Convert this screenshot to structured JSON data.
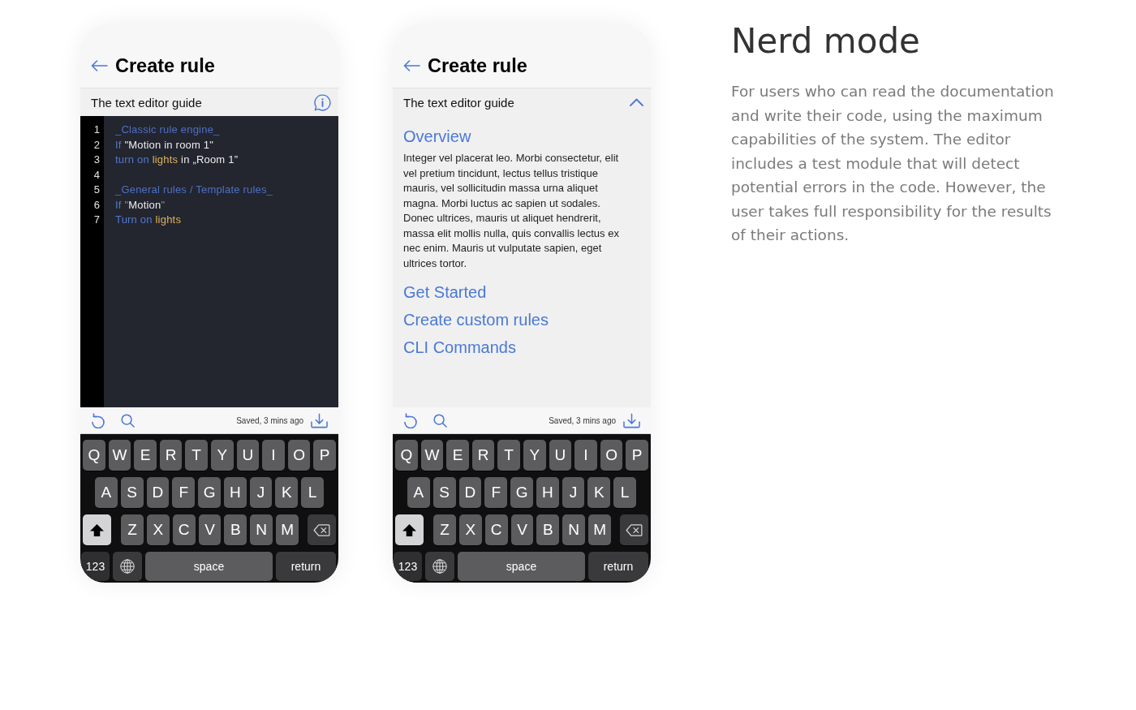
{
  "phones": [
    {
      "header": {
        "title": "Create rule"
      },
      "guide_bar": {
        "label": "The text editor guide",
        "expanded": false
      },
      "editor": {
        "lines": [
          {
            "number": "1",
            "tokens": [
              {
                "text": "_Classic rule engine_",
                "kind": "comment"
              }
            ]
          },
          {
            "number": "2",
            "tokens": [
              {
                "text": "If ",
                "kind": "keyword"
              },
              {
                "text": "\"Motion in room 1\"",
                "kind": "string"
              }
            ]
          },
          {
            "number": "3",
            "tokens": [
              {
                "text": "turn on ",
                "kind": "keyword"
              },
              {
                "text": "lights",
                "kind": "entity"
              },
              {
                "text": " in „Room 1”",
                "kind": "plain"
              }
            ]
          },
          {
            "number": "4"
          },
          {
            "number": "5",
            "tokens": [
              {
                "text": "_General rules / Template rules_",
                "kind": "comment"
              }
            ]
          },
          {
            "number": "6",
            "tokens": [
              {
                "text": "If ",
                "kind": "keyword"
              },
              {
                "text": "\"",
                "kind": "punctuation"
              },
              {
                "text": "Motion",
                "kind": "plain"
              },
              {
                "text": "\"",
                "kind": "punctuation"
              }
            ]
          },
          {
            "number": "7",
            "tokens": [
              {
                "text": "Turn on ",
                "kind": "keyword"
              },
              {
                "text": "lights",
                "kind": "entity"
              }
            ]
          }
        ]
      },
      "toolbar": {
        "status": "Saved, 3 mins ago"
      },
      "keyboard": {
        "rows": [
          {
            "keys": [
              {
                "kind": "letter",
                "label": "Q"
              },
              {
                "kind": "letter",
                "label": "W"
              },
              {
                "kind": "letter",
                "label": "E"
              },
              {
                "kind": "letter",
                "label": "R"
              },
              {
                "kind": "letter",
                "label": "T"
              },
              {
                "kind": "letter",
                "label": "Y"
              },
              {
                "kind": "letter",
                "label": "U"
              },
              {
                "kind": "letter",
                "label": "I"
              },
              {
                "kind": "letter",
                "label": "O"
              },
              {
                "kind": "letter",
                "label": "P"
              }
            ]
          },
          {
            "keys": [
              {
                "kind": "letter",
                "label": "A"
              },
              {
                "kind": "letter",
                "label": "S"
              },
              {
                "kind": "letter",
                "label": "D"
              },
              {
                "kind": "letter",
                "label": "F"
              },
              {
                "kind": "letter",
                "label": "G"
              },
              {
                "kind": "letter",
                "label": "H"
              },
              {
                "kind": "letter",
                "label": "J"
              },
              {
                "kind": "letter",
                "label": "K"
              },
              {
                "kind": "letter",
                "label": "L"
              }
            ]
          },
          {
            "keys": [
              {
                "kind": "shift",
                "on": true
              },
              {
                "kind": "letter",
                "label": "Z"
              },
              {
                "kind": "letter",
                "label": "X"
              },
              {
                "kind": "letter",
                "label": "C"
              },
              {
                "kind": "letter",
                "label": "V"
              },
              {
                "kind": "letter",
                "label": "B"
              },
              {
                "kind": "letter",
                "label": "N"
              },
              {
                "kind": "letter",
                "label": "M"
              },
              {
                "kind": "delete"
              }
            ]
          },
          {
            "keys": [
              {
                "kind": "numbers",
                "label": "123"
              },
              {
                "kind": "globe"
              },
              {
                "kind": "space",
                "label": "space"
              },
              {
                "kind": "return",
                "label": "return"
              }
            ]
          }
        ]
      }
    },
    {
      "header": {
        "title": "Create rule"
      },
      "guide_bar": {
        "label": "The text editor guide",
        "expanded": true
      },
      "guide": {
        "sections": [
          {
            "title": "Overview",
            "body": "Integer vel placerat leo. Morbi consectetur, elit vel pretium tincidunt, lectus tellus tristique mauris, vel sollicitudin massa urna aliquet magna. Morbi luctus ac sapien ut sodales. Donec ultrices, mauris ut aliquet hendrerit, massa elit mollis nulla, quis convallis lectus ex nec enim. Mauris ut vulputate sapien, eget ultrices tortor."
          },
          {
            "title": "Get Started"
          },
          {
            "title": "Create custom rules"
          },
          {
            "title": "CLI Commands"
          }
        ]
      },
      "toolbar": {
        "status": "Saved, 3 mins ago"
      },
      "keyboard": {
        "rows": [
          {
            "keys": [
              {
                "kind": "letter",
                "label": "Q"
              },
              {
                "kind": "letter",
                "label": "W"
              },
              {
                "kind": "letter",
                "label": "E"
              },
              {
                "kind": "letter",
                "label": "R"
              },
              {
                "kind": "letter",
                "label": "T"
              },
              {
                "kind": "letter",
                "label": "Y"
              },
              {
                "kind": "letter",
                "label": "U"
              },
              {
                "kind": "letter",
                "label": "I"
              },
              {
                "kind": "letter",
                "label": "O"
              },
              {
                "kind": "letter",
                "label": "P"
              }
            ]
          },
          {
            "keys": [
              {
                "kind": "letter",
                "label": "A"
              },
              {
                "kind": "letter",
                "label": "S"
              },
              {
                "kind": "letter",
                "label": "D"
              },
              {
                "kind": "letter",
                "label": "F"
              },
              {
                "kind": "letter",
                "label": "G"
              },
              {
                "kind": "letter",
                "label": "H"
              },
              {
                "kind": "letter",
                "label": "J"
              },
              {
                "kind": "letter",
                "label": "K"
              },
              {
                "kind": "letter",
                "label": "L"
              }
            ]
          },
          {
            "keys": [
              {
                "kind": "shift",
                "on": true
              },
              {
                "kind": "letter",
                "label": "Z"
              },
              {
                "kind": "letter",
                "label": "X"
              },
              {
                "kind": "letter",
                "label": "C"
              },
              {
                "kind": "letter",
                "label": "V"
              },
              {
                "kind": "letter",
                "label": "B"
              },
              {
                "kind": "letter",
                "label": "N"
              },
              {
                "kind": "letter",
                "label": "M"
              },
              {
                "kind": "delete"
              }
            ]
          },
          {
            "keys": [
              {
                "kind": "numbers",
                "label": "123"
              },
              {
                "kind": "globe"
              },
              {
                "kind": "space",
                "label": "space"
              },
              {
                "kind": "return",
                "label": "return"
              }
            ]
          }
        ]
      }
    }
  ],
  "description": {
    "title": "Nerd mode",
    "body": "For users who can read the documentation and write their code, using the maximum capabilities of the system. The editor includes a test module that will detect potential errors in the code. However, the user takes full responsibility for the results of their actions."
  }
}
